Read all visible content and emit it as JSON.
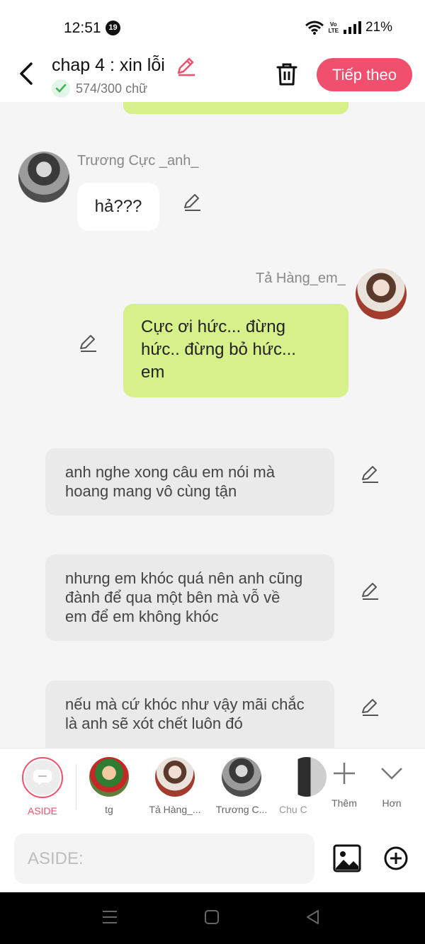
{
  "status_bar": {
    "time": "12:51",
    "notification_count": "19",
    "volte": "Vo LTE",
    "battery": "21%"
  },
  "header": {
    "title": "chap 4 : xin lỗi",
    "word_count": "574/300 chữ",
    "next_label": "Tiếp theo",
    "accent": "#f0506e"
  },
  "messages": [
    {
      "speaker": "Trương Cực _anh_",
      "text": "hả???"
    },
    {
      "speaker": "Tả Hàng_em_",
      "lines": [
        "Cực ơi hức... đừng",
        "hức.. đừng bỏ hức...",
        "em"
      ]
    }
  ],
  "narrations": [
    {
      "lines": [
        "anh nghe xong câu em nói mà",
        "hoang mang vô cùng tận"
      ]
    },
    {
      "lines": [
        "nhưng em khóc quá nên anh cũng",
        "đành để qua một bên mà vỗ về",
        "em để em không khóc"
      ]
    },
    {
      "lines": [
        "nếu mà cứ khóc như vậy mãi chắc",
        "là anh sẽ xót chết luôn đó"
      ]
    }
  ],
  "characters": [
    {
      "label": "ASIDE",
      "selected": true
    },
    {
      "label": "tg"
    },
    {
      "label": "Tả Hàng_..."
    },
    {
      "label": "Trương C..."
    },
    {
      "label": "Chu C"
    },
    {
      "label": "Thêm"
    },
    {
      "label": "Hơn"
    }
  ],
  "input": {
    "placeholder": "ASIDE:"
  },
  "colors": {
    "green_bubble": "#d7f18a",
    "narration_bg": "#eaeaea"
  }
}
